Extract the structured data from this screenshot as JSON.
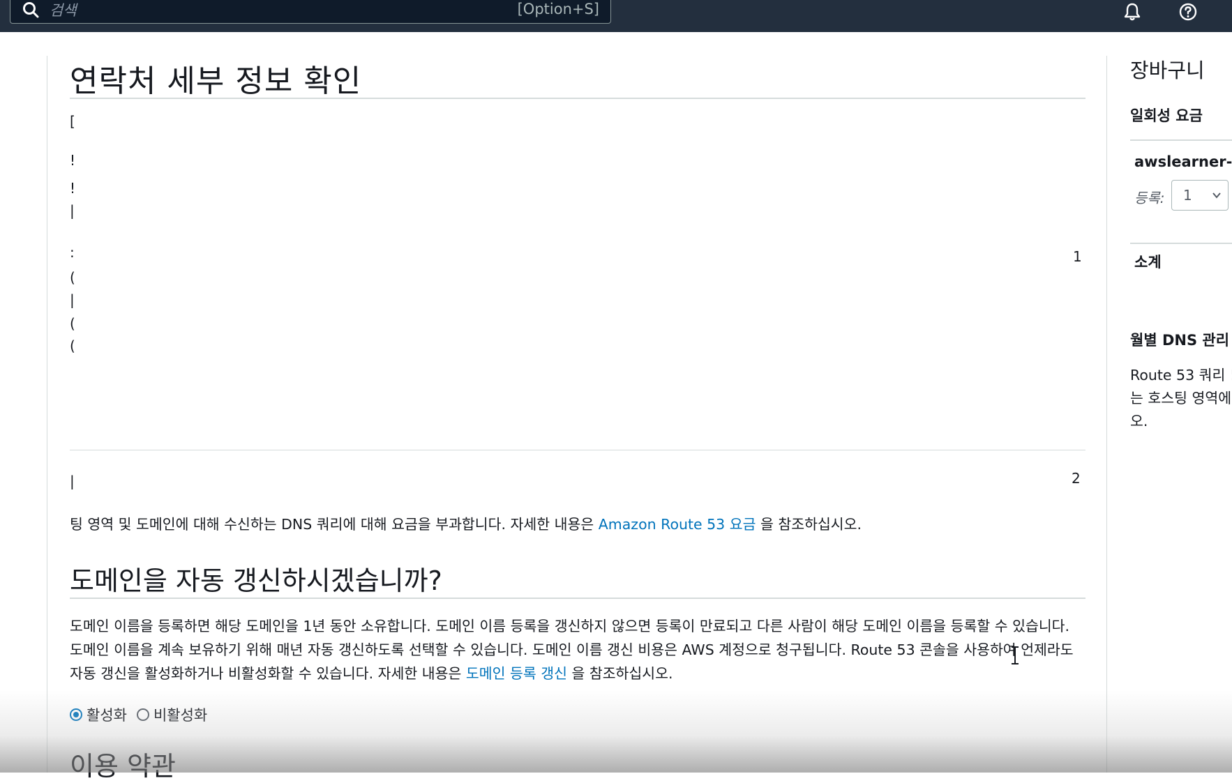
{
  "topbar": {
    "search_placeholder": "검색",
    "search_shortcut": "[Option+S]"
  },
  "main": {
    "page_title": "연락처 세부 정보 확인",
    "row_number_1": "1",
    "row_number_2": "2",
    "pricing_text_before": "팅 영역 및 도메인에 대해 수신하는 DNS 쿼리에 대해 요금을 부과합니다. 자세한 내용은 ",
    "pricing_link": "Amazon Route 53 요금",
    "pricing_text_after": " 을 참조하십시오.",
    "auto_renew": {
      "title": "도메인을 자동 갱신하시겠습니까?",
      "description_before": "도메인 이름을 등록하면 해당 도메인을 1년 동안 소유합니다. 도메인 이름 등록을 갱신하지 않으면 등록이 만료되고 다른 사람이 해당 도메인 이름을 등록할 수 있습니다. 도메인 이름을 계속 보유하기 위해 매년 자동 갱신하도록 선택할 수 있습니다. 도메인 이름 갱신 비용은 AWS 계정으로 청구됩니다. Route 53 콘솔을 사용하여 언제라도 자동 갱신을 활성화하거나 비활성화할 수 있습니다. 자세한 내용은 ",
      "description_link": "도메인 등록 갱신",
      "description_after": " 을 참조하십시오.",
      "options": [
        "활성화",
        "비활성화"
      ],
      "selected": "활성화"
    },
    "terms_title": "이용 약관"
  },
  "cart": {
    "title": "장바구니",
    "one_time_fee": "일회성 요금",
    "domain": "awslearner-si",
    "registration_label": "등록:",
    "registration_years": "1",
    "subtotal": "소계",
    "monthly_dns": "월별 DNS 관리 .",
    "monthly_dns_text_line1": "Route 53 쿼리 !",
    "monthly_dns_text_line2": "는 호스팅 영역에",
    "monthly_dns_text_line3": "오."
  },
  "colors": {
    "topbar": "#232f3e",
    "link": "#0073bb",
    "border": "#d5dbdb"
  }
}
